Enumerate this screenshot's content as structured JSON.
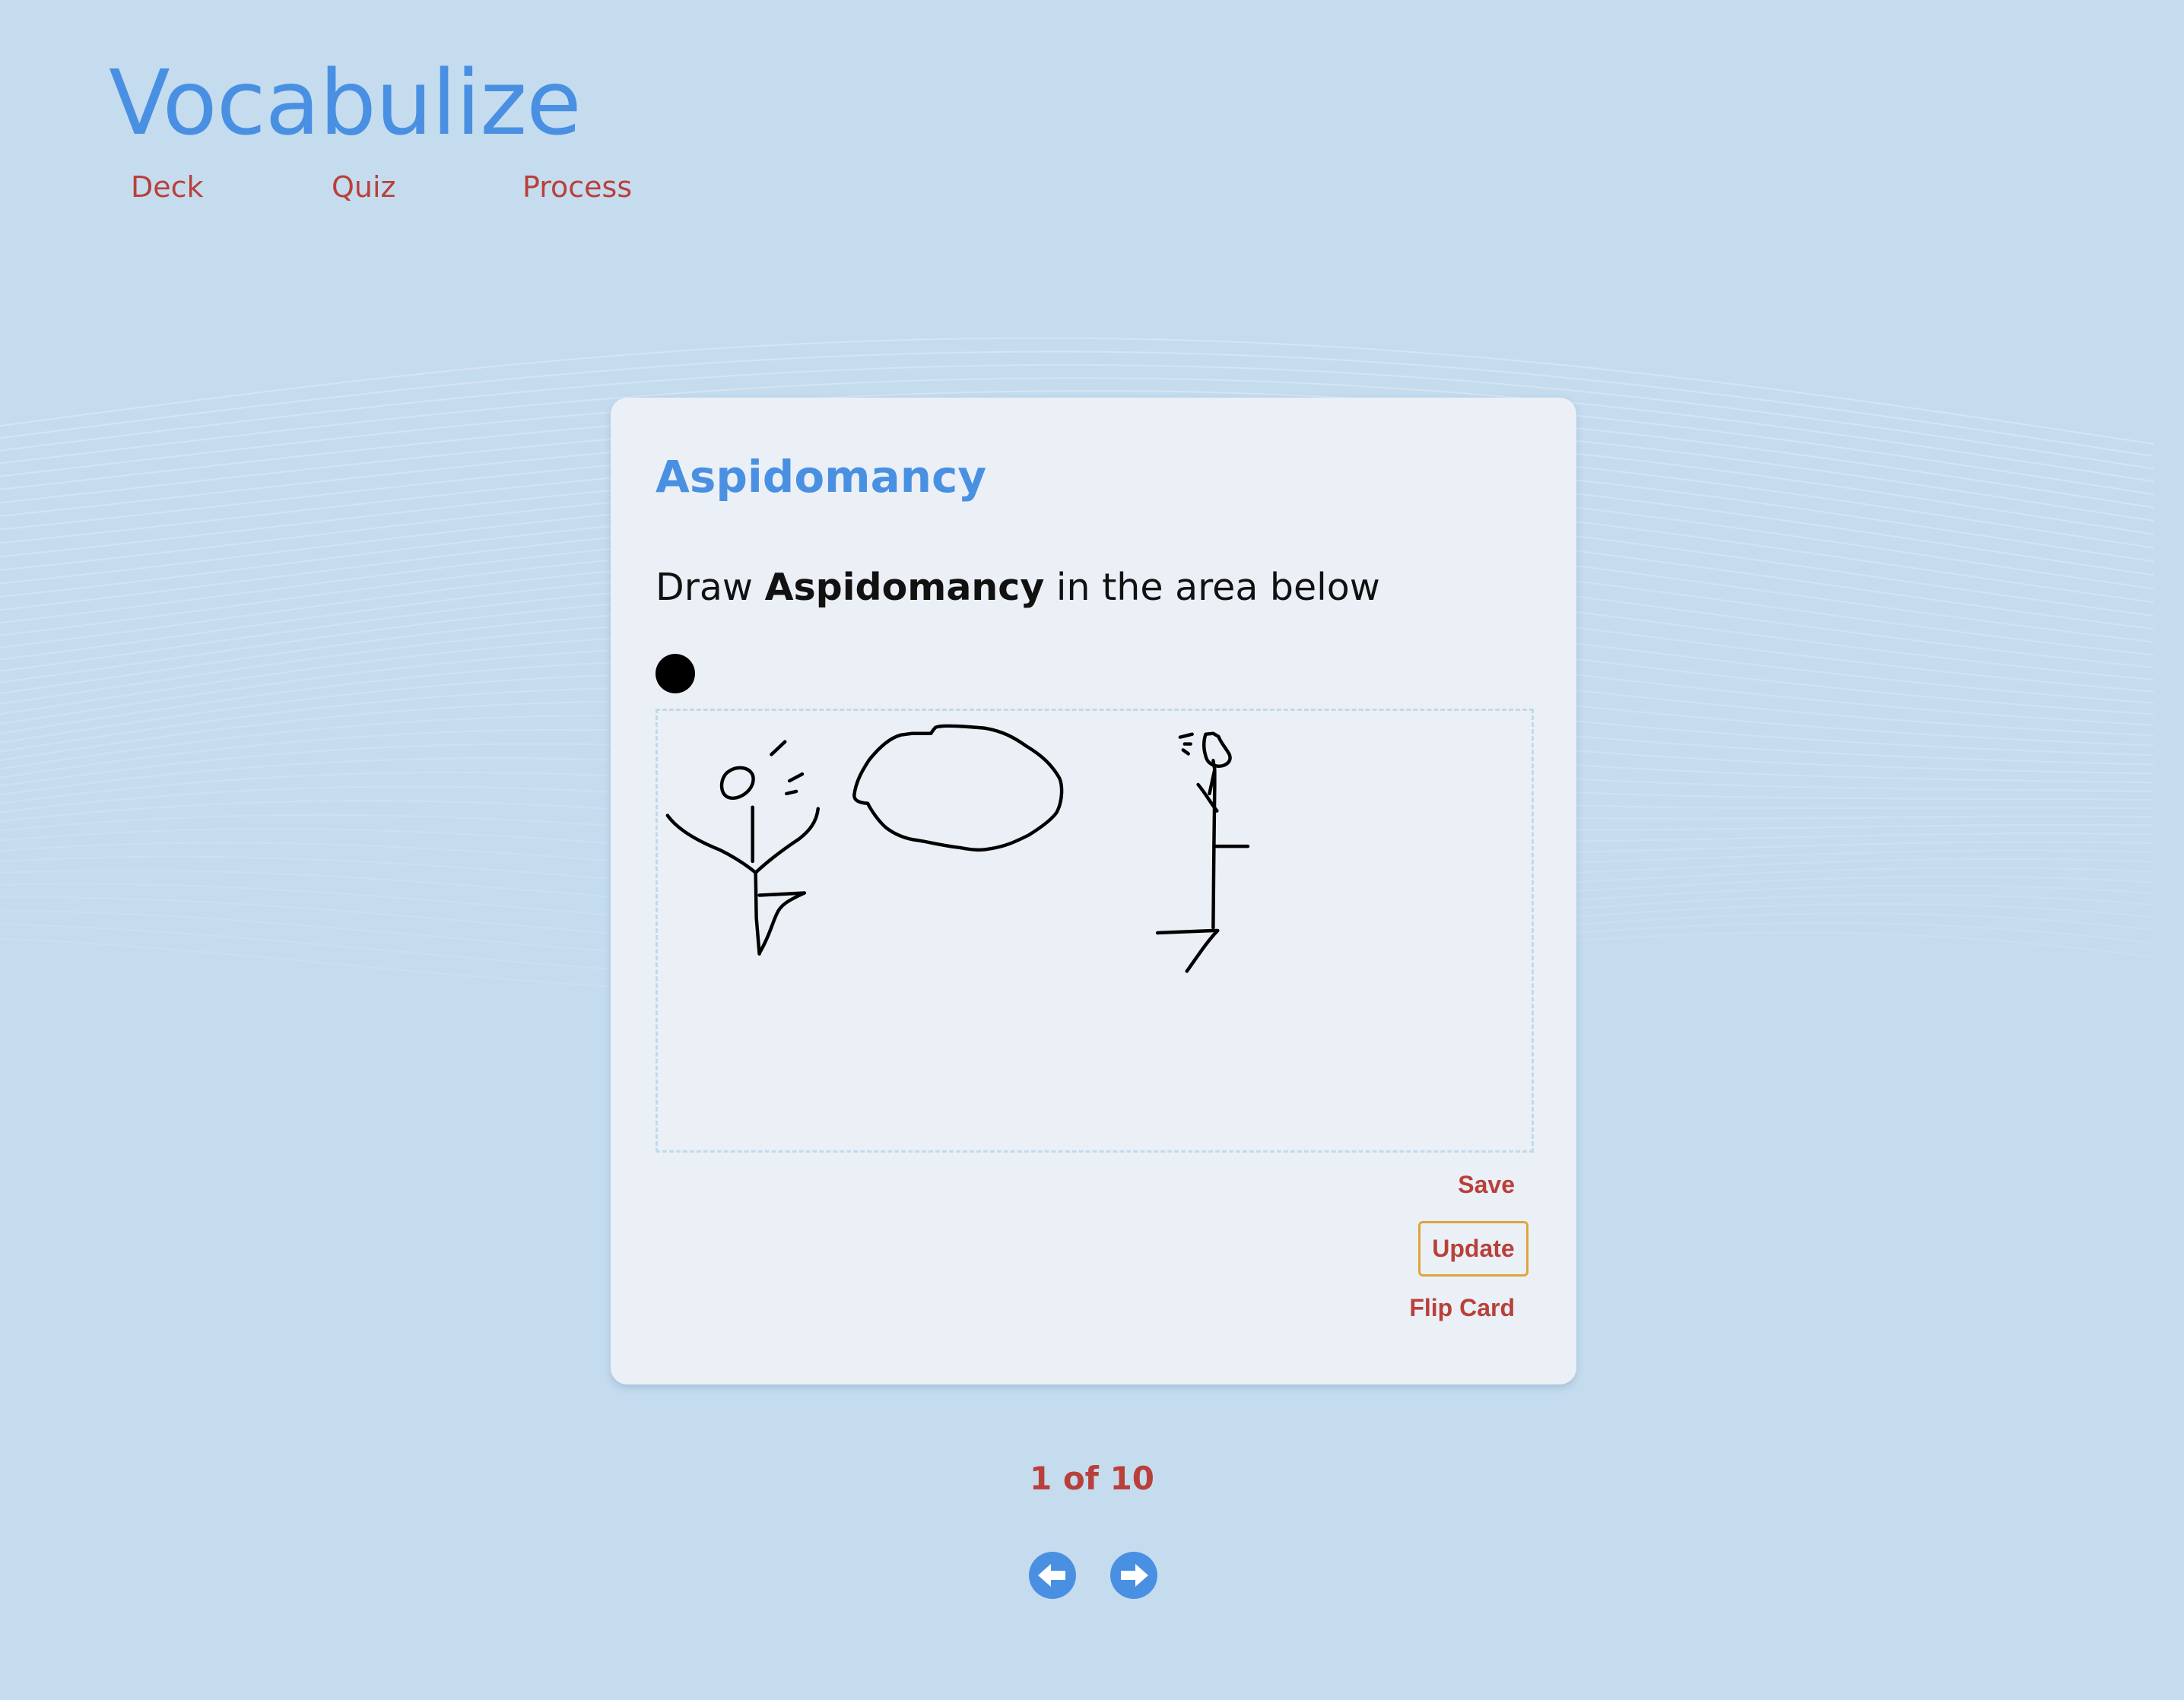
{
  "app": {
    "title": "Vocabulize"
  },
  "nav": {
    "items": [
      {
        "label": "Deck"
      },
      {
        "label": "Quiz"
      },
      {
        "label": "Process"
      }
    ]
  },
  "card": {
    "title": "Aspidomancy",
    "instruction_prefix": "Draw ",
    "instruction_word": "Aspidomancy",
    "instruction_suffix": " in the area below",
    "brush_color": "#000000",
    "drawing_description": "two stick figures with a large oval between them",
    "save_label": "Save",
    "update_label": "Update",
    "flip_label": "Flip Card"
  },
  "pager": {
    "label": "1 of 10",
    "prev_icon": "arrow-left-icon",
    "next_icon": "arrow-right-icon"
  },
  "colors": {
    "background": "#c5dcef",
    "card": "#ebf0f6",
    "accent_blue": "#4a90e2",
    "accent_red": "#b9403a",
    "update_border": "#e0a43c"
  }
}
